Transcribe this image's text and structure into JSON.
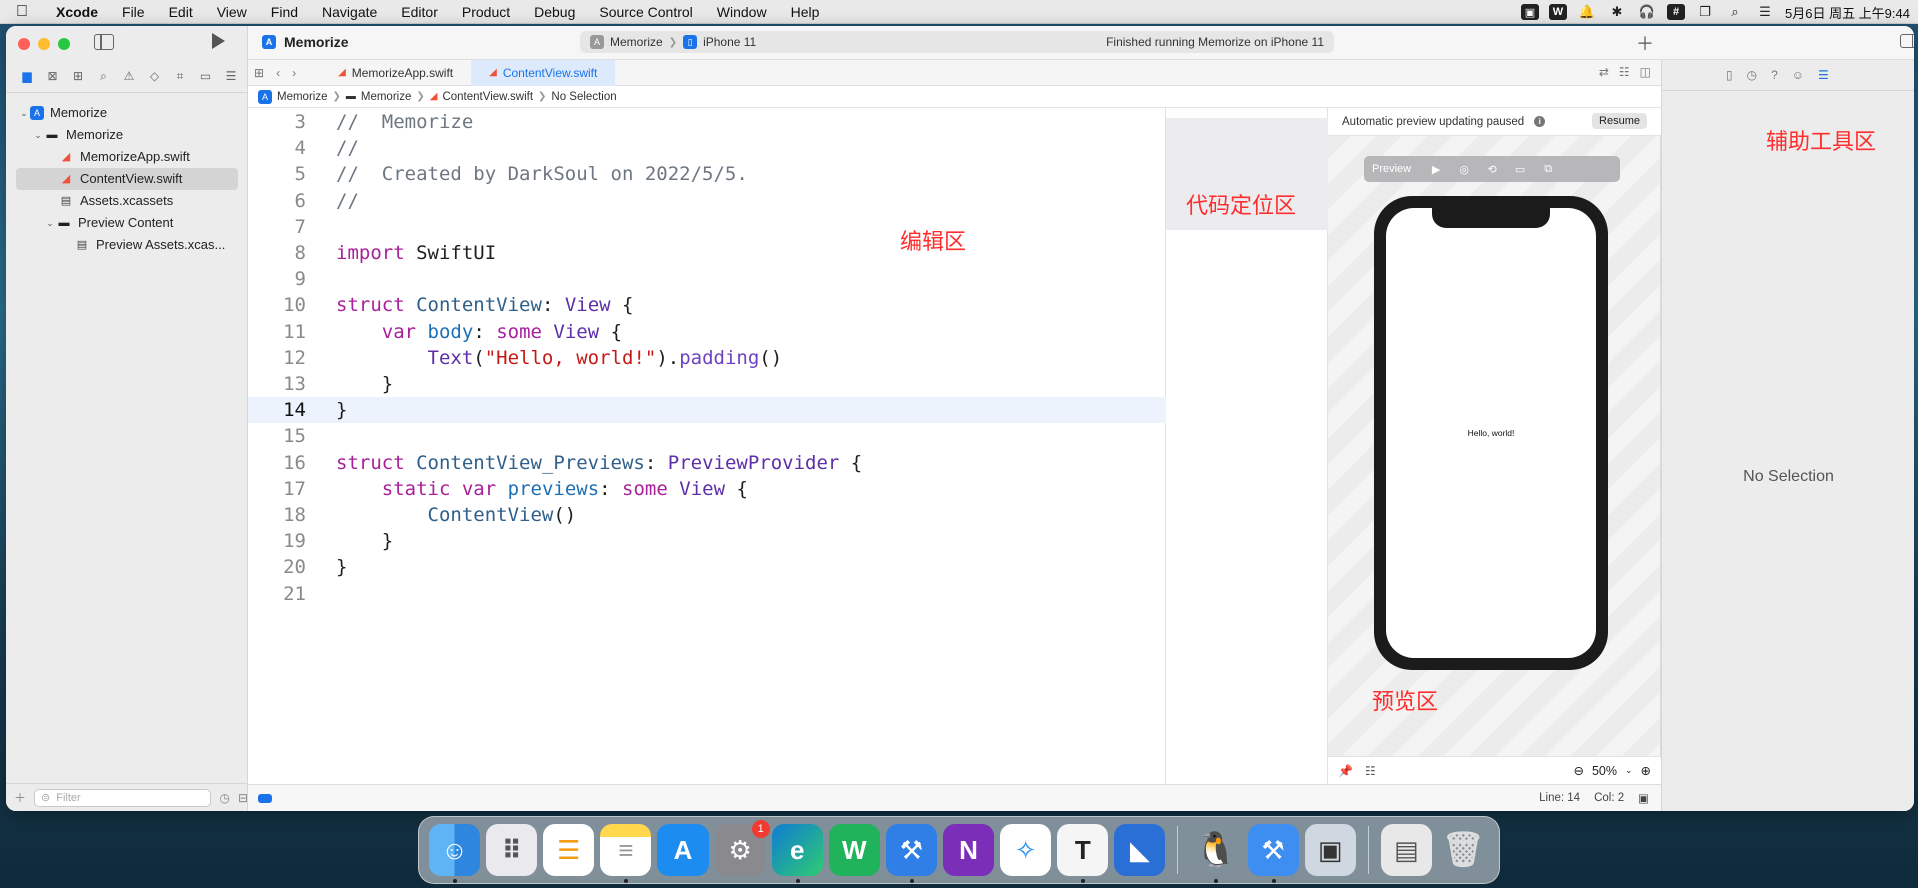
{
  "menubar": {
    "app_name": "Xcode",
    "items": [
      "File",
      "Edit",
      "View",
      "Find",
      "Navigate",
      "Editor",
      "Product",
      "Debug",
      "Source Control",
      "Window",
      "Help"
    ],
    "clock": "5月6日 周五 上午9:44",
    "status_icons": [
      "image-icon",
      "word-icon",
      "bell-icon",
      "bluetooth-icon",
      "headphones-icon",
      "grid-icon",
      "window-icon",
      "search-icon",
      "control-center-icon"
    ]
  },
  "toolbar": {
    "project_title": "Memorize",
    "scheme": "Memorize",
    "device": "iPhone 11",
    "status": "Finished running Memorize on iPhone 11"
  },
  "tabs": [
    {
      "label": "MemorizeApp.swift",
      "active": false
    },
    {
      "label": "ContentView.swift",
      "active": true
    }
  ],
  "jumpbar": [
    "Memorize",
    "Memorize",
    "ContentView.swift",
    "No Selection"
  ],
  "navigator": {
    "items": [
      {
        "label": "Memorize",
        "kind": "project",
        "indent": 0
      },
      {
        "label": "Memorize",
        "kind": "folder",
        "indent": 1
      },
      {
        "label": "MemorizeApp.swift",
        "kind": "swift",
        "indent": 2
      },
      {
        "label": "ContentView.swift",
        "kind": "swift",
        "indent": 2,
        "selected": true
      },
      {
        "label": "Assets.xcassets",
        "kind": "assets",
        "indent": 2
      },
      {
        "label": "Preview Content",
        "kind": "folder",
        "indent": 2
      },
      {
        "label": "Preview Assets.xcas...",
        "kind": "assets",
        "indent": 3
      }
    ],
    "filter_placeholder": "Filter"
  },
  "editor": {
    "current_line": 14,
    "lines": [
      {
        "n": "3",
        "html": "<span class='tok-comment'>//  Memorize</span>"
      },
      {
        "n": "4",
        "html": "<span class='tok-comment'>//</span>"
      },
      {
        "n": "5",
        "html": "<span class='tok-comment'>//  Created by DarkSoul on 2022/5/5.</span>"
      },
      {
        "n": "6",
        "html": "<span class='tok-comment'>//</span>"
      },
      {
        "n": "7",
        "html": ""
      },
      {
        "n": "8",
        "html": "<span class='tok-kw'>import</span> SwiftUI"
      },
      {
        "n": "9",
        "html": ""
      },
      {
        "n": "10",
        "html": "<span class='tok-kw'>struct</span> <span class='tok-type'>ContentView</span>: <span class='tok-type2'>View</span> {"
      },
      {
        "n": "11",
        "html": "    <span class='tok-kw'>var</span> <span class='tok-prop'>body</span>: <span class='tok-kw'>some</span> <span class='tok-type2'>View</span> {"
      },
      {
        "n": "12",
        "html": "        <span class='tok-type2'>Text</span>(<span class='tok-str'>\"Hello, world!\"</span>).<span class='tok-func'>padding</span>()"
      },
      {
        "n": "13",
        "html": "    }"
      },
      {
        "n": "14",
        "html": "}"
      },
      {
        "n": "15",
        "html": ""
      },
      {
        "n": "16",
        "html": "<span class='tok-kw'>struct</span> <span class='tok-type'>ContentView_Previews</span>: <span class='tok-type2'>PreviewProvider</span> {"
      },
      {
        "n": "17",
        "html": "    <span class='tok-kw'>static</span> <span class='tok-kw'>var</span> <span class='tok-prop'>previews</span>: <span class='tok-kw'>some</span> <span class='tok-type2'>View</span> {"
      },
      {
        "n": "18",
        "html": "        <span class='tok-type'>ContentView</span>()"
      },
      {
        "n": "19",
        "html": "    }"
      },
      {
        "n": "20",
        "html": "}"
      },
      {
        "n": "21",
        "html": ""
      }
    ]
  },
  "annotations": {
    "editor_area": "编辑区",
    "minimap_area": "代码定位区",
    "preview_area": "预览区",
    "inspector_area": "辅助工具区"
  },
  "canvas": {
    "paused_text": "Automatic preview updating paused",
    "resume_label": "Resume",
    "preview_label": "Preview",
    "screen_text": "Hello, world!",
    "zoom": "50%"
  },
  "inspector": {
    "empty_text": "No Selection"
  },
  "statusbar": {
    "line": "Line: 14",
    "col": "Col: 2"
  },
  "dock": {
    "apps": [
      "finder",
      "launchpad",
      "reminders",
      "notes",
      "app-store",
      "system-preferences",
      "edge",
      "wps",
      "xcode",
      "onenote",
      "safari",
      "typora",
      "file-transfer",
      "qq",
      "simulator",
      "preview",
      "documents",
      "trash"
    ],
    "badge_count": "1"
  },
  "colors": {
    "accent": "#1a73e8",
    "annotation_red": "#ff2d2d",
    "swift_orange": "#f05138"
  }
}
